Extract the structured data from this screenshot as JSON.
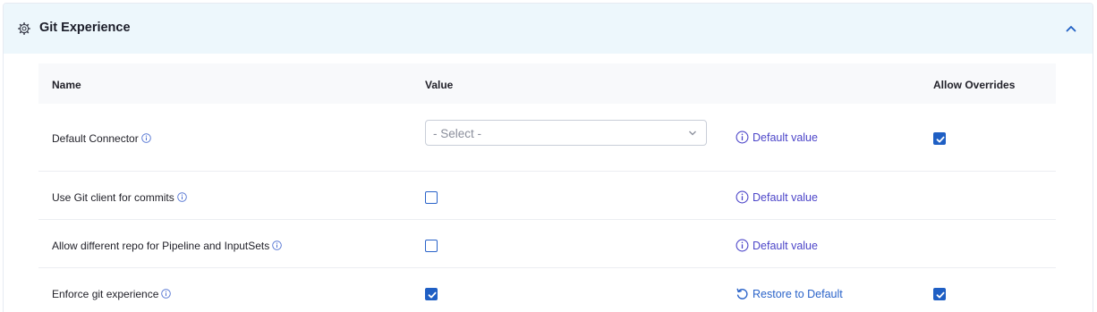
{
  "section": {
    "title": "Git Experience",
    "icon": "gear-icon",
    "collapse_icon": "chevron-up-icon"
  },
  "table": {
    "headers": {
      "name": "Name",
      "value": "Value",
      "overrides": "Allow Overrides"
    },
    "rows": [
      {
        "name": "Default Connector",
        "value_type": "select",
        "select_placeholder": "- Select -",
        "action_label": "Default value",
        "action_icon": "info-icon",
        "allow_overrides": true
      },
      {
        "name": "Use Git client for commits",
        "value_type": "checkbox",
        "checked": false,
        "action_label": "Default value",
        "action_icon": "info-icon",
        "allow_overrides": null
      },
      {
        "name": "Allow different repo for Pipeline and InputSets",
        "value_type": "checkbox",
        "checked": false,
        "action_label": "Default value",
        "action_icon": "info-icon",
        "allow_overrides": null
      },
      {
        "name": "Enforce git experience",
        "value_type": "checkbox",
        "checked": true,
        "action_label": "Restore to Default",
        "action_icon": "restore-icon",
        "allow_overrides": true
      }
    ]
  },
  "colors": {
    "header_bg": "#edf7fc",
    "accent": "#1f5fc4",
    "link": "#4d46c9"
  }
}
